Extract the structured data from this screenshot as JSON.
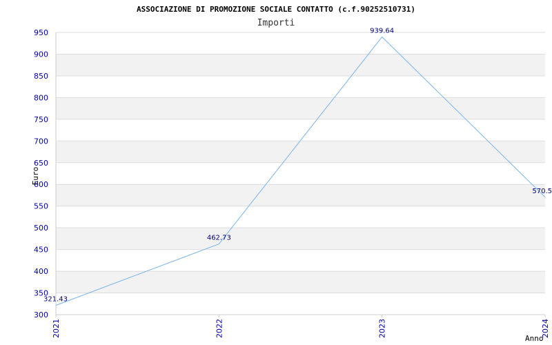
{
  "chart_data": {
    "type": "line",
    "title": "ASSOCIAZIONE DI PROMOZIONE SOCIALE CONTATTO (c.f.90252510731)",
    "subtitle": "Importi",
    "xlabel": "Anno",
    "ylabel": "Euro",
    "categories": [
      "2021",
      "2022",
      "2023",
      "2024"
    ],
    "series": [
      {
        "values": [
          321.43,
          462.73,
          939.64,
          570.5
        ]
      }
    ],
    "data_labels": [
      "321.43",
      "462.73",
      "939.64",
      "570.5"
    ],
    "ylim": [
      300,
      950
    ],
    "yticks": [
      300,
      350,
      400,
      450,
      500,
      550,
      600,
      650,
      700,
      750,
      800,
      850,
      900,
      950
    ],
    "grid": true,
    "colors": {
      "line": "#7ab4ee",
      "band": "#f2f2f2",
      "gridline": "#dddddd",
      "tick_text": "#0000aa",
      "label_text": "#000080"
    }
  }
}
